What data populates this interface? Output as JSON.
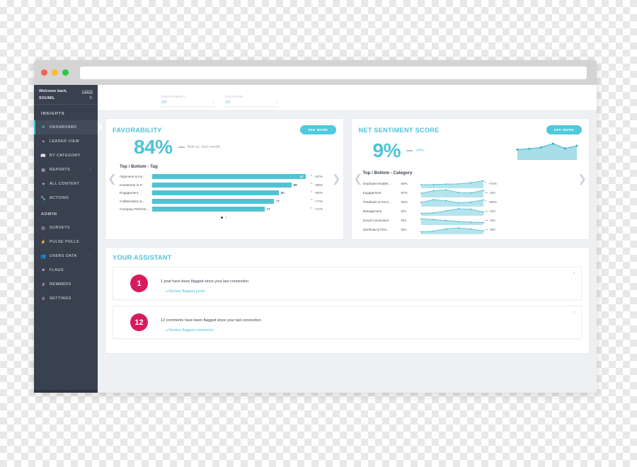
{
  "browser": {
    "traffic_lights": [
      "close",
      "minimize",
      "maximize"
    ],
    "url_value": "",
    "url_placeholder": ""
  },
  "sidebar": {
    "welcome_text": "Welcome back,",
    "logout_label": "Logout",
    "username": "SOUMIL",
    "refresh_icon": "refresh-icon",
    "sections": [
      {
        "title": "INSIGHTS",
        "items": [
          {
            "label": "DASHBOARD",
            "icon": "gauge-icon",
            "active": true,
            "chevron": ""
          },
          {
            "label": "LEADER VIEW",
            "icon": "diamond-icon",
            "active": false,
            "chevron": ""
          },
          {
            "label": "BY CATEGORY",
            "icon": "book-icon",
            "active": false,
            "chevron": ""
          },
          {
            "label": "REPORTS",
            "icon": "image-icon",
            "active": false,
            "chevron": "‹"
          },
          {
            "label": "ALL CONTENT",
            "icon": "heart-icon",
            "active": false,
            "chevron": ""
          },
          {
            "label": "ACTIONS",
            "icon": "wrench-icon",
            "active": false,
            "chevron": ""
          }
        ]
      },
      {
        "title": "ADMIN",
        "items": [
          {
            "label": "SURVEYS",
            "icon": "list-icon",
            "active": false,
            "chevron": ""
          },
          {
            "label": "PULSE POLLS",
            "icon": "bolt-icon",
            "active": false,
            "chevron": ""
          },
          {
            "label": "USERS DATA",
            "icon": "users-icon",
            "active": false,
            "chevron": "‹"
          },
          {
            "label": "FLAGS",
            "icon": "flag-icon",
            "active": false,
            "chevron": ""
          },
          {
            "label": "REWARDS",
            "icon": "crown-icon",
            "active": false,
            "chevron": ""
          },
          {
            "label": "SETTINGS",
            "icon": "gear-icon",
            "active": false,
            "chevron": ""
          }
        ]
      }
    ]
  },
  "filters": [
    {
      "label": "DEPARTMENT",
      "value": "All",
      "icon": "updown-arrows-icon"
    },
    {
      "label": "LOCATION",
      "value": "All",
      "icon": "updown-arrows-icon"
    }
  ],
  "favorability": {
    "title": "FAVORABILITY",
    "see_more_label": "SEE MORE",
    "big_value": "84%",
    "delta_icon": "flat-dash-icon",
    "delta_text": "N/A vs. last month",
    "sub_head": "Top / Bottom - Tag",
    "pagination": {
      "total": 2,
      "active_index": 0
    },
    "prev_icon": "chevron-left-icon",
    "next_icon": "chevron-right-icon"
  },
  "net_sentiment": {
    "title": "NET SENTIMENT SCORE",
    "see_more_label": "SEE MORE",
    "big_value": "9%",
    "delta_icon": "flat-dash-icon",
    "delta_text": "+0%",
    "sub_head": "Top / Bottom - Category",
    "prev_icon": "chevron-left-icon",
    "next_icon": "chevron-right-icon"
  },
  "assistant": {
    "title": "YOUR ASSISTANT",
    "close_icon": "close-icon",
    "items": [
      {
        "count": "1",
        "message": "1 post have been flagged since your last connection",
        "link": "Review flagged posts",
        "link_caret": "▸"
      },
      {
        "count": "12",
        "message": "12 comments have been flagged since your last connection",
        "link": "Review flagged comments",
        "link_caret": "▸"
      }
    ]
  },
  "colors": {
    "accent_teal": "#4fc3d8",
    "bar_teal": "#4fc3d4",
    "sidebar_dark": "#39414f",
    "badge_pink": "#d81b5f",
    "muted_gray": "#9aa5b1"
  },
  "chart_data": [
    {
      "type": "bar",
      "title": "Top / Bottom - Tag",
      "orientation": "horizontal",
      "categories": [
        "Alignment & Inv...",
        "Investment in P...",
        "Engagement",
        "Collaboration &...",
        "Company Perform..."
      ],
      "values": [
        97,
        88,
        80,
        77,
        71
      ],
      "value_labels": [
        "97",
        "88",
        "80",
        "77",
        "71"
      ],
      "trend_labels": [
        "+97%",
        "+88%",
        "+80%",
        "+77%",
        "+71%"
      ],
      "trend_icons": [
        "caret-up",
        "caret-up",
        "caret-up",
        "caret-up",
        "caret-up"
      ],
      "xlabel": "",
      "ylabel": "",
      "xlim": [
        0,
        100
      ],
      "grid": false,
      "legend": false
    },
    {
      "type": "area",
      "title": "Net Sentiment Trend",
      "x": [
        1,
        2,
        3,
        4,
        5,
        6
      ],
      "values": [
        28,
        34,
        44,
        70,
        36,
        55
      ],
      "ylim": [
        0,
        100
      ],
      "grid": false,
      "legend": false
    },
    {
      "type": "table",
      "title": "Top / Bottom - Category",
      "columns": [
        "Category",
        "Score",
        "Sparkline",
        "Trend"
      ],
      "rows": [
        {
          "category": "Employee Enable...",
          "score": "93%",
          "spark": [
            22,
            24,
            30,
            32,
            46,
            72
          ],
          "trend": "+74%",
          "trend_icon": "caret-up"
        },
        {
          "category": "Engagement",
          "score": "67%",
          "spark": [
            30,
            62,
            72,
            40,
            34,
            66
          ],
          "trend": "N/A",
          "trend_icon": "flat-dash"
        },
        {
          "category": "Feedback & Reco...",
          "score": "33%",
          "spark": [
            32,
            64,
            52,
            28,
            34,
            62
          ],
          "trend": "+59%",
          "trend_icon": "caret-up"
        },
        {
          "category": "Management",
          "score": "N/A",
          "spark": [
            10,
            14,
            40,
            66,
            60,
            26
          ],
          "trend": "N/A",
          "trend_icon": "flat-dash"
        },
        {
          "category": "Social Connection",
          "score": "N/A",
          "spark": [
            56,
            46,
            34,
            22,
            14,
            10
          ],
          "trend": "N/A",
          "trend_icon": "flat-dash"
        },
        {
          "category": "Workload & Flex...",
          "score": "N/A",
          "spark": [
            8,
            18,
            44,
            58,
            42,
            20
          ],
          "trend": "N/A",
          "trend_icon": "flat-dash"
        }
      ]
    }
  ]
}
